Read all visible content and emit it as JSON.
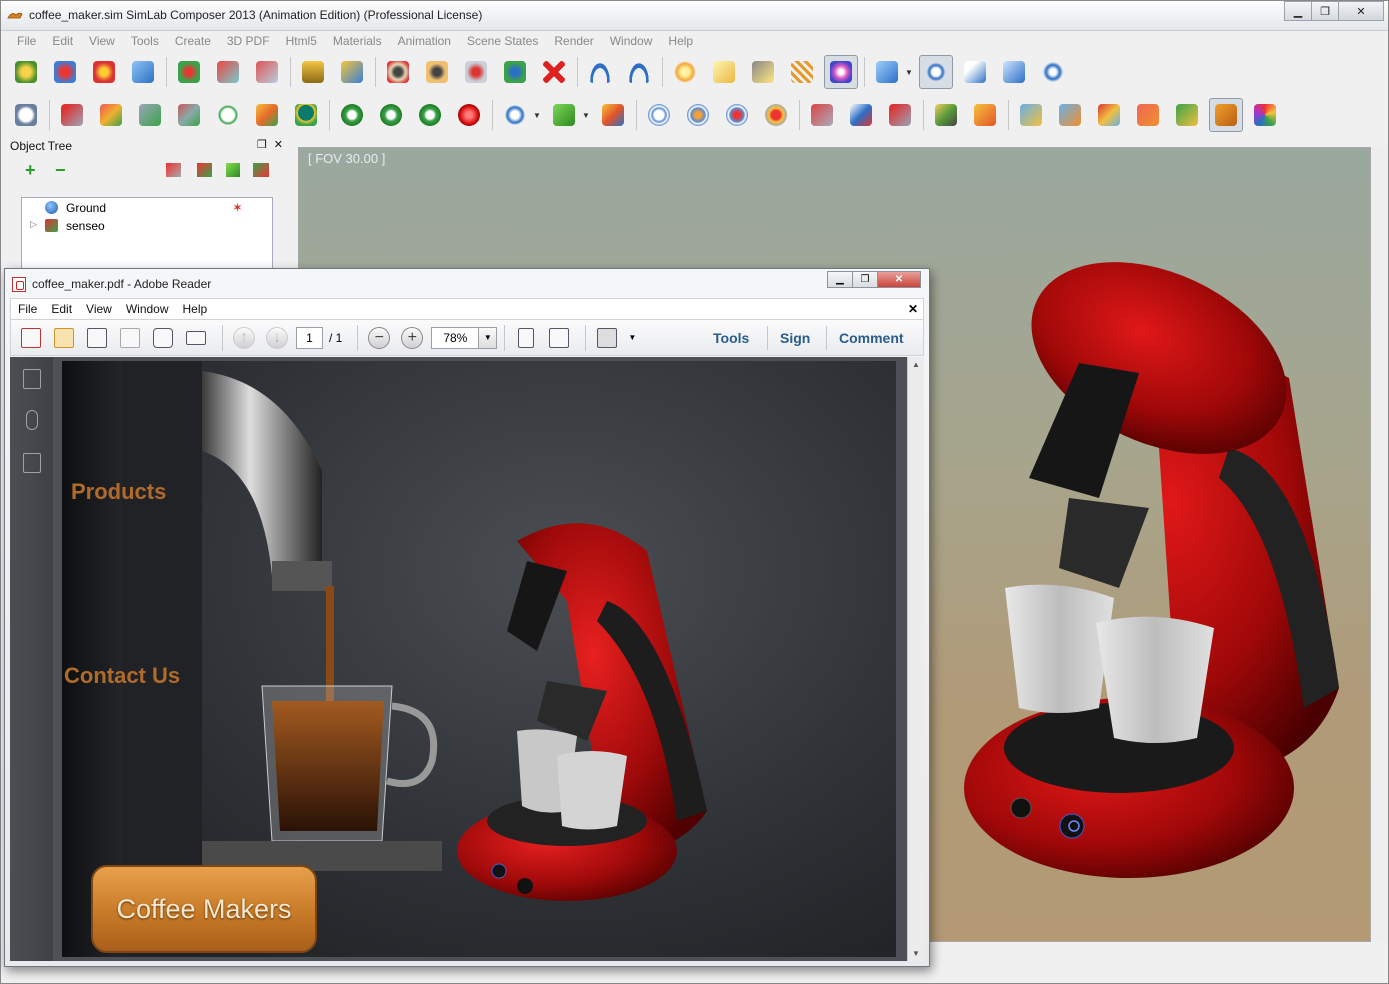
{
  "simlab": {
    "title": "coffee_maker.sim SimLab Composer 2013 (Animation Edition)   (Professional License)",
    "menu": [
      "File",
      "Edit",
      "View",
      "Tools",
      "Create",
      "3D PDF",
      "Html5",
      "Materials",
      "Animation",
      "Scene States",
      "Render",
      "Window",
      "Help"
    ],
    "object_tree": {
      "title": "Object Tree",
      "items": [
        {
          "label": "Ground"
        },
        {
          "label": "senseo"
        }
      ]
    },
    "viewport": {
      "fov_label": "[ FOV 30.00 ]"
    }
  },
  "reader": {
    "title": "coffee_maker.pdf - Adobe Reader",
    "menu": [
      "File",
      "Edit",
      "View",
      "Window",
      "Help"
    ],
    "page_current": "1",
    "page_total": "/ 1",
    "zoom": "78%",
    "links": {
      "tools": "Tools",
      "sign": "Sign",
      "comment": "Comment"
    }
  },
  "pdf_page": {
    "products": "Products",
    "contact": "Contact Us",
    "button": "Coffee Makers"
  }
}
